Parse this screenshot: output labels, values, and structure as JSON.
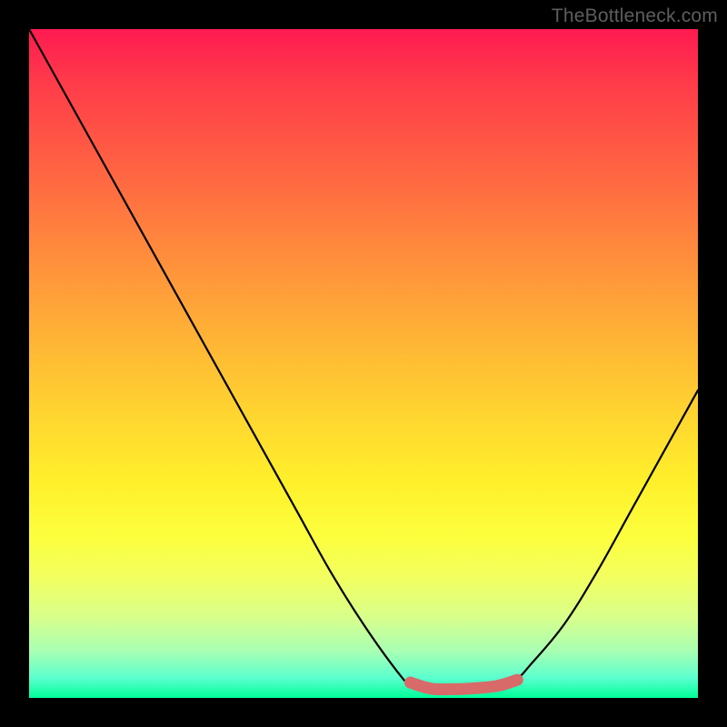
{
  "attribution": "TheBottleneck.com",
  "chart_data": {
    "type": "line",
    "title": "",
    "xlabel": "",
    "ylabel": "",
    "xlim": [
      0,
      100
    ],
    "ylim": [
      0,
      100
    ],
    "series": [
      {
        "name": "bottleneck-curve",
        "x": [
          0,
          5,
          10,
          15,
          20,
          25,
          30,
          35,
          40,
          45,
          50,
          55,
          57,
          60,
          63,
          66,
          70,
          73,
          75,
          80,
          85,
          90,
          95,
          100
        ],
        "y": [
          100,
          91,
          82,
          73,
          64,
          55,
          46,
          37,
          28,
          19,
          11,
          4,
          2,
          1,
          1,
          1,
          2,
          3,
          5,
          11,
          19,
          28,
          37,
          46
        ]
      },
      {
        "name": "bottleneck-highlight-zone",
        "x": [
          57,
          60,
          63,
          66,
          70,
          73
        ],
        "y": [
          2.3,
          1.4,
          1.3,
          1.4,
          1.8,
          2.7
        ]
      }
    ],
    "optimal_marker": {
      "x": 57,
      "y": 2.3
    },
    "colors": {
      "curve": "#000000",
      "highlight": "#d86a6a",
      "marker": "#d86a6a"
    }
  }
}
